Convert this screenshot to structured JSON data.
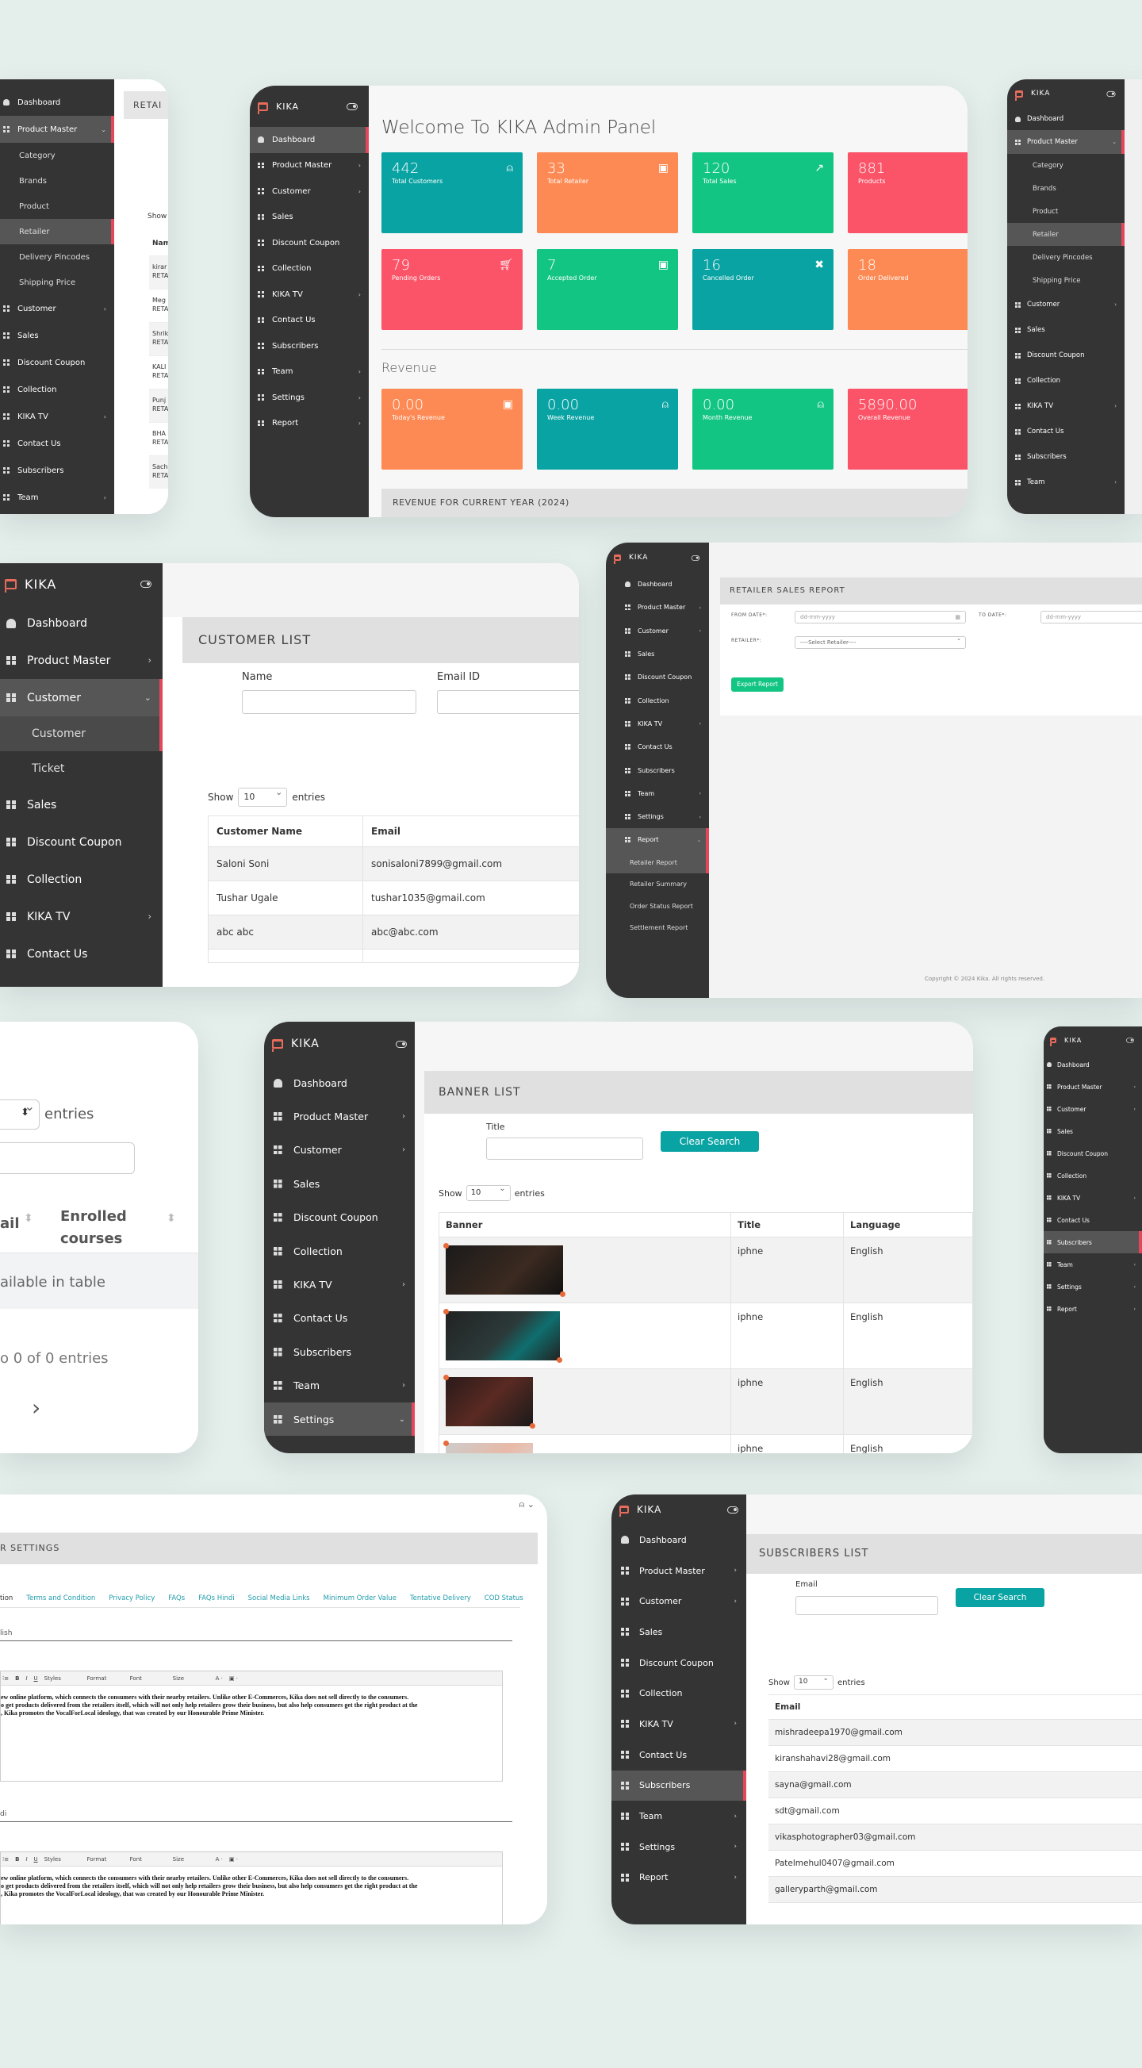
{
  "brand": "KIKA",
  "colors": {
    "teal": "#0aa3a3",
    "orange": "#fd8a54",
    "green": "#13c583",
    "red": "#fb5367",
    "sidebar": "#343434",
    "active_marker": "#e5475a",
    "background": "#e4efec"
  },
  "menu": {
    "dashboard": "Dashboard",
    "product_master": "Product Master",
    "customer": "Customer",
    "sales": "Sales",
    "discount_coupon": "Discount Coupon",
    "collection": "Collection",
    "kika_tv": "KIKA TV",
    "contact_us": "Contact Us",
    "subscribers": "Subscribers",
    "team": "Team",
    "settings": "Settings",
    "report": "Report"
  },
  "product_sub": [
    "Category",
    "Brands",
    "Product",
    "Retailer",
    "Delivery Pincodes",
    "Shipping Price"
  ],
  "customer_sub": [
    "Customer",
    "Ticket"
  ],
  "report_sub": [
    "Retailer Report",
    "Retailer Summary",
    "Order Status Report",
    "Settlement Report"
  ],
  "panel1": {
    "header_partial": "RETAI",
    "show": "Show",
    "header_col": "Nam",
    "rows": [
      [
        "kirar",
        "RETA"
      ],
      [
        "Meg",
        "RETA"
      ],
      [
        "Shrik",
        "RETA"
      ],
      [
        "KALI",
        "RETA"
      ],
      [
        "Punj",
        "RETA"
      ],
      [
        "BHA",
        "RETA"
      ],
      [
        "Sach",
        "RETA"
      ]
    ]
  },
  "dashboard": {
    "welcome": "Welcome To KIKA Admin Panel",
    "stats": [
      {
        "value": "442",
        "label": "Total Customers",
        "icon": "user-icon",
        "color": "teal"
      },
      {
        "value": "33",
        "label": "Total Retailer",
        "icon": "briefcase-icon",
        "color": "orange"
      },
      {
        "value": "120",
        "label": "Total Sales",
        "icon": "trend-icon",
        "color": "green"
      },
      {
        "value": "881",
        "label": "Products",
        "icon": "box-icon",
        "color": "red"
      },
      {
        "value": "79",
        "label": "Pending Orders",
        "icon": "cart-icon",
        "color": "red"
      },
      {
        "value": "7",
        "label": "Accepted Order",
        "icon": "briefcase-icon",
        "color": "green"
      },
      {
        "value": "16",
        "label": "Cancelled Order",
        "icon": "close-icon",
        "color": "teal"
      },
      {
        "value": "18",
        "label": "Order Delivered",
        "icon": "check-icon",
        "color": "orange"
      }
    ],
    "revenue_title": "Revenue",
    "revenue": [
      {
        "value": "0.00",
        "label": "Today's Revenue",
        "icon": "briefcase-icon",
        "color": "orange"
      },
      {
        "value": "0.00",
        "label": "Week Revenue",
        "icon": "user-icon",
        "color": "teal"
      },
      {
        "value": "0.00",
        "label": "Month Revenue",
        "icon": "user-icon",
        "color": "green"
      },
      {
        "value": "5890.00",
        "label": "Overall Revenue",
        "icon": "briefcase-icon",
        "color": "red"
      }
    ],
    "year_bar": "REVENUE FOR CURRENT YEAR (2024)"
  },
  "customer_list": {
    "title": "CUSTOMER LIST",
    "name_label": "Name",
    "email_label": "Email ID",
    "show": "Show",
    "entries_val": "10",
    "entries": "entries",
    "col_name": "Customer Name",
    "col_email": "Email",
    "rows": [
      [
        "Saloni Soni",
        "sonisaloni7899@gmail.com"
      ],
      [
        "Tushar Ugale",
        "tushar1035@gmail.com"
      ],
      [
        "abc abc",
        "abc@abc.com"
      ]
    ]
  },
  "report": {
    "title": "RETAILER SALES REPORT",
    "from": "FROM DATE*:",
    "to": "TO DATE*:",
    "date_ph": "dd-mm-yyyy",
    "retailer": "RETAILER*:",
    "retailer_ph": "----Select Retailer----",
    "export": "Export Report",
    "copyright": "Copyright © 2024 Kika. All rights reserved."
  },
  "courses": {
    "entries": "entries",
    "col1": "ail",
    "col2": "Enrolled courses",
    "empty": "ailable in table",
    "info": "o 0 of 0 entries",
    "next": "›"
  },
  "banner": {
    "title": "BANNER LIST",
    "title_label": "Title",
    "clear": "Clear Search",
    "show": "Show",
    "entries_val": "10",
    "entries": "entries",
    "col_banner": "Banner",
    "col_title": "Title",
    "col_lang": "Language",
    "rows": [
      [
        "iphne",
        "English"
      ],
      [
        "iphne",
        "English"
      ],
      [
        "iphne",
        "English"
      ],
      [
        "iphne",
        "English"
      ]
    ]
  },
  "settings": {
    "title_partial": "R SETTINGS",
    "tabs": [
      "tion",
      "Terms and Condition",
      "Privacy Policy",
      "FAQs",
      "FAQs Hindi",
      "Social Media Links",
      "Minimum Order Value",
      "Tentative Delivery",
      "COD Status"
    ],
    "field1": "lish",
    "field2": "di",
    "tb_styles": "Styles",
    "tb_format": "Format",
    "tb_font": "Font",
    "tb_size": "Size",
    "text_lines": [
      "ew online platform, which connects the consumers with their nearby retailers. Unlike other E-Commerces, Kika does not sell directly to the consumers.",
      "o get products delivered from the retailers itself, which will not only help retailers grow their business, but also help consumers get the right product at the",
      ", Kika promotes the VocalForLocal ideology, that was created by our Honourable Prime Minister."
    ]
  },
  "subscribers": {
    "title": "SUBSCRIBERS LIST",
    "email_label": "Email",
    "clear": "Clear Search",
    "show": "Show",
    "entries_val": "10",
    "entries": "entries",
    "col_email": "Email",
    "rows": [
      "mishradeepa1970@gmail.com",
      "kiranshahavi28@gmail.com",
      "sayna@gmail.com",
      "sdt@gmail.com",
      "vikasphotographer03@gmail.com",
      "Patelmehul0407@gmail.com",
      "galleryparth@gmail.com"
    ]
  }
}
